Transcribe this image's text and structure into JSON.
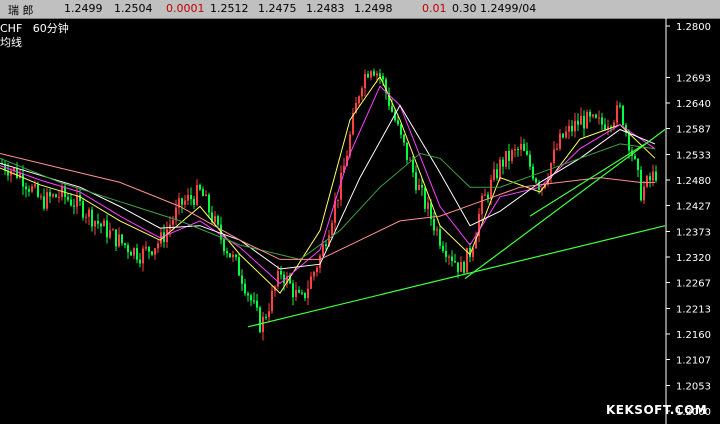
{
  "quote_bar": {
    "name": "瑞 郎",
    "v1": "1.2499",
    "v2": "1.2504",
    "change": "0.0001",
    "v3": "1.2512",
    "v4": "1.2475",
    "v5": "1.2483",
    "v6": "1.2498",
    "change2": "0.01",
    "v7": "0.30",
    "v8": "1.2499/04"
  },
  "title": {
    "symbol": "CHF",
    "period": "60分钟",
    "subtitle": "均线"
  },
  "watermark": "KEKSOFT.COM",
  "colors": {
    "background": "#000000",
    "axis": "#ffffff",
    "candle_up": "#ff4040",
    "candle_down": "#00ff40",
    "ma_white": "#ffffff",
    "ma_yellow": "#ffff60",
    "ma_magenta": "#ff40ff",
    "ma_green": "#40a040",
    "ma_pink": "#ff9090",
    "trendline": "#40ff40"
  },
  "chart_data": {
    "type": "line",
    "ylim": [
      1.2,
      1.283
    ],
    "y_ticks": [
      "1.2800",
      "1.2693",
      "1.2640",
      "1.2587",
      "1.2533",
      "1.2480",
      "1.2427",
      "1.2373",
      "1.2320",
      "1.2267",
      "1.2213",
      "1.2160",
      "1.2107",
      "1.2053",
      "1.2000"
    ],
    "y_tick_values": [
      1.28,
      1.2693,
      1.264,
      1.2587,
      1.2533,
      1.248,
      1.2427,
      1.2373,
      1.232,
      1.2267,
      1.2213,
      1.216,
      1.2107,
      1.2053,
      1.2
    ],
    "price_series": {
      "x": [
        0,
        20,
        40,
        60,
        80,
        100,
        120,
        140,
        160,
        180,
        200,
        220,
        240,
        260,
        280,
        300,
        320,
        340,
        360,
        370,
        380,
        400,
        420,
        440,
        460,
        470,
        480,
        500,
        520,
        540,
        560,
        580,
        600,
        620,
        630,
        640,
        655
      ],
      "values": [
        1.2515,
        1.249,
        1.2435,
        1.245,
        1.2425,
        1.2385,
        1.235,
        1.2325,
        1.2355,
        1.243,
        1.2455,
        1.236,
        1.2285,
        1.2175,
        1.229,
        1.2225,
        1.2325,
        1.2475,
        1.2685,
        1.272,
        1.2695,
        1.2565,
        1.245,
        1.2355,
        1.2295,
        1.2335,
        1.2425,
        1.2515,
        1.2545,
        1.2465,
        1.2565,
        1.2605,
        1.2595,
        1.2625,
        1.2545,
        1.2455,
        1.2495
      ]
    },
    "moving_averages": [
      {
        "color_key": "ma_yellow",
        "x": [
          0,
          40,
          80,
          120,
          160,
          200,
          240,
          280,
          320,
          350,
          380,
          400,
          440,
          470,
          500,
          540,
          580,
          620,
          655
        ],
        "values": [
          1.2505,
          1.247,
          1.2445,
          1.2395,
          1.2355,
          1.2425,
          1.2325,
          1.2245,
          1.2375,
          1.2605,
          1.2695,
          1.2605,
          1.2385,
          1.2325,
          1.2485,
          1.2455,
          1.2565,
          1.2595,
          1.2525
        ]
      },
      {
        "color_key": "ma_magenta",
        "x": [
          0,
          40,
          80,
          120,
          160,
          200,
          240,
          280,
          320,
          350,
          380,
          400,
          440,
          470,
          500,
          540,
          580,
          620,
          655
        ],
        "values": [
          1.251,
          1.248,
          1.2455,
          1.2405,
          1.236,
          1.2395,
          1.234,
          1.2265,
          1.2335,
          1.2535,
          1.2675,
          1.2635,
          1.2425,
          1.2345,
          1.2445,
          1.2465,
          1.2545,
          1.2595,
          1.2545
        ]
      },
      {
        "color_key": "ma_white",
        "x": [
          0,
          40,
          80,
          120,
          160,
          200,
          240,
          280,
          320,
          360,
          400,
          440,
          470,
          500,
          540,
          580,
          620,
          655
        ],
        "values": [
          1.2515,
          1.249,
          1.2465,
          1.2425,
          1.238,
          1.2385,
          1.2355,
          1.2295,
          1.2305,
          1.2485,
          1.2635,
          1.2495,
          1.2385,
          1.2415,
          1.2475,
          1.2525,
          1.2585,
          1.2555
        ]
      },
      {
        "color_key": "ma_green",
        "x": [
          0,
          60,
          120,
          180,
          240,
          300,
          340,
          380,
          420,
          440,
          470,
          500,
          540,
          580,
          620,
          655
        ],
        "values": [
          1.2525,
          1.2475,
          1.2435,
          1.2395,
          1.2345,
          1.2315,
          1.2375,
          1.2465,
          1.2535,
          1.2525,
          1.2465,
          1.2465,
          1.2495,
          1.2525,
          1.2555,
          1.2545
        ]
      },
      {
        "color_key": "ma_pink",
        "x": [
          0,
          60,
          120,
          180,
          240,
          280,
          320,
          360,
          400,
          440,
          480,
          520,
          560,
          600,
          640,
          655
        ],
        "values": [
          1.2535,
          1.2505,
          1.2475,
          1.2425,
          1.2355,
          1.2315,
          1.2315,
          1.2355,
          1.2395,
          1.2405,
          1.2435,
          1.2465,
          1.2475,
          1.2485,
          1.2475,
          1.2475
        ]
      }
    ],
    "trendlines": [
      {
        "x": [
          248,
          665
        ],
        "values": [
          1.2175,
          1.2385
        ]
      },
      {
        "x": [
          465,
          665
        ],
        "values": [
          1.2275,
          1.2585
        ]
      },
      {
        "x": [
          530,
          645
        ],
        "values": [
          1.2405,
          1.2555
        ]
      }
    ]
  }
}
